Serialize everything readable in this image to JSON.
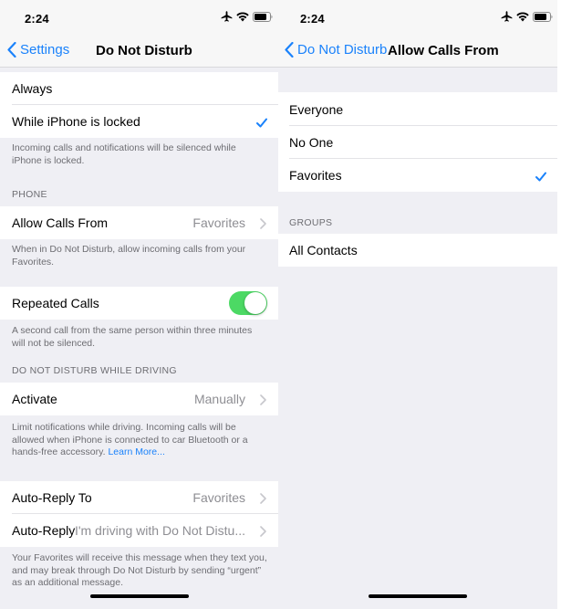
{
  "left": {
    "status": {
      "time": "2:24"
    },
    "nav": {
      "back_label": "Settings",
      "title": "Do Not Disturb"
    },
    "silence": {
      "always": "Always",
      "locked": "While iPhone is locked",
      "note": "Incoming calls and notifications will be silenced while iPhone is locked."
    },
    "phone": {
      "header": "PHONE",
      "allow_label": "Allow Calls From",
      "allow_value": "Favorites",
      "allow_note": "When in Do Not Disturb, allow incoming calls from your Favorites.",
      "repeated_label": "Repeated Calls",
      "repeated_on": true,
      "repeated_note": "A second call from the same person within three minutes will not be silenced."
    },
    "driving": {
      "header": "DO NOT DISTURB WHILE DRIVING",
      "activate_label": "Activate",
      "activate_value": "Manually",
      "note": "Limit notifications while driving. Incoming calls will be allowed when iPhone is connected to car Bluetooth or a hands-free accessory.",
      "learn_more": "Learn More..."
    },
    "autoreply": {
      "to_label": "Auto-Reply To",
      "to_value": "Favorites",
      "reply_label": "Auto-Reply",
      "reply_value": "I'm driving with Do Not Distu...",
      "note": "Your Favorites will receive this message when they text you, and may break through Do Not Disturb by sending “urgent” as an additional message."
    }
  },
  "right": {
    "status": {
      "time": "2:24"
    },
    "nav": {
      "back_label": "Do Not Disturb",
      "title": "Allow Calls From"
    },
    "options": {
      "everyone": "Everyone",
      "no_one": "No One",
      "favorites": "Favorites"
    },
    "groups": {
      "header": "GROUPS",
      "all_contacts": "All Contacts"
    }
  },
  "colors": {
    "accent": "#1a82fb",
    "toggle_on": "#4cd964",
    "background": "#efeff4",
    "secondary_text": "#8e8e93"
  },
  "icons": [
    "airplane-icon",
    "wifi-icon",
    "battery-icon",
    "chevron-left-icon",
    "chevron-right-icon",
    "checkmark-icon"
  ]
}
